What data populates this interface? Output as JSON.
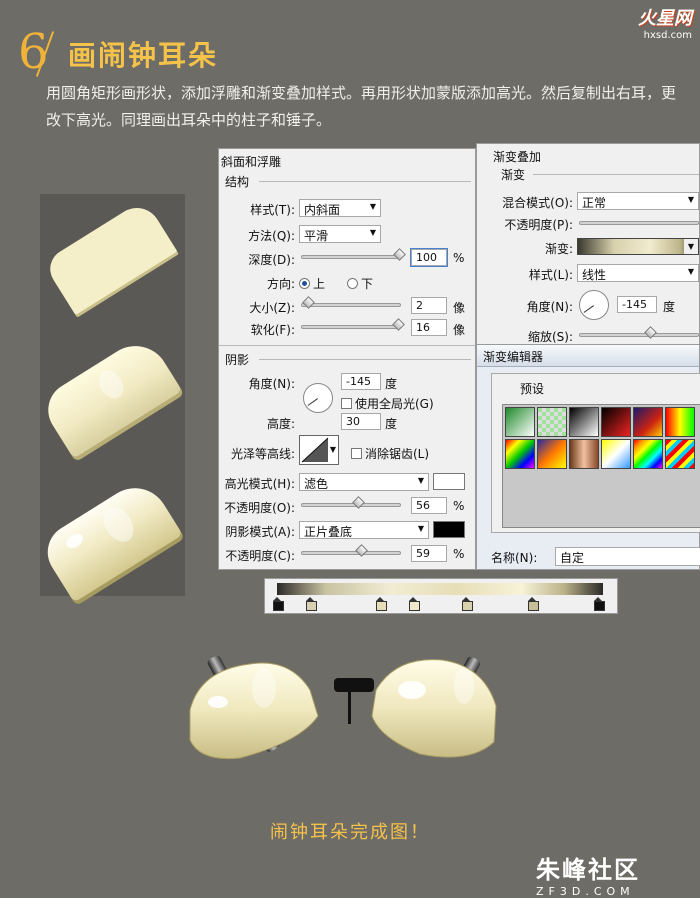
{
  "header": {
    "step_number": "6",
    "title": "画闹钟耳朵",
    "description": "用圆角矩形画形状，添加浮雕和渐变叠加样式。再用形状加蒙版添加高光。然后复制出右耳，更改下高光。同理画出耳朵中的柱子和锤子。",
    "site_logo": "火星网",
    "site_url": "hxsd.com"
  },
  "bevel_panel": {
    "title": "斜面和浮雕",
    "structure_label": "结构",
    "style_label": "样式(T):",
    "style_value": "内斜面",
    "technique_label": "方法(Q):",
    "technique_value": "平滑",
    "depth_label": "深度(D):",
    "depth_value": "100",
    "depth_unit": "%",
    "depth_pct": 100,
    "direction_label": "方向:",
    "dir_up": "上",
    "dir_down": "下",
    "size_label": "大小(Z):",
    "size_value": "2",
    "size_unit": "像",
    "soften_label": "软化(F):",
    "soften_value": "16",
    "soften_unit": "像",
    "shading_label": "阴影",
    "angle_label": "角度(N):",
    "angle_value": "-145",
    "angle_unit": "度",
    "global_light_label": "使用全局光(G)",
    "altitude_label": "高度:",
    "altitude_value": "30",
    "altitude_unit": "度",
    "gloss_label": "光泽等高线:",
    "antialias_label": "消除锯齿(L)",
    "highlight_mode_label": "高光模式(H):",
    "highlight_mode_value": "滤色",
    "highlight_color": "#ffffff",
    "hl_opacity_label": "不透明度(O):",
    "hl_opacity_value": "56",
    "hl_opacity_unit": "%",
    "shadow_mode_label": "阴影模式(A):",
    "shadow_mode_value": "正片叠底",
    "shadow_color": "#000000",
    "sh_opacity_label": "不透明度(C):",
    "sh_opacity_value": "59",
    "sh_opacity_unit": "%"
  },
  "gradient_overlay": {
    "title": "渐变叠加",
    "section_label": "渐变",
    "blend_label": "混合模式(O):",
    "blend_value": "正常",
    "opacity_label": "不透明度(P):",
    "gradient_label": "渐变:",
    "style_label": "样式(L):",
    "style_value": "线性",
    "angle_label": "角度(N):",
    "angle_value": "-145",
    "angle_unit": "度",
    "scale_label": "缩放(S):"
  },
  "gradient_editor": {
    "title": "渐变编辑器",
    "presets_label": "预设",
    "name_label": "名称(N):",
    "name_value": "自定"
  },
  "footer": {
    "caption": "闹钟耳朵完成图！",
    "logo_name": "朱峰社区",
    "logo_url": "ZF3D.COM"
  },
  "colors": {
    "accent": "#f5c24a",
    "background": "#6e6c66"
  }
}
